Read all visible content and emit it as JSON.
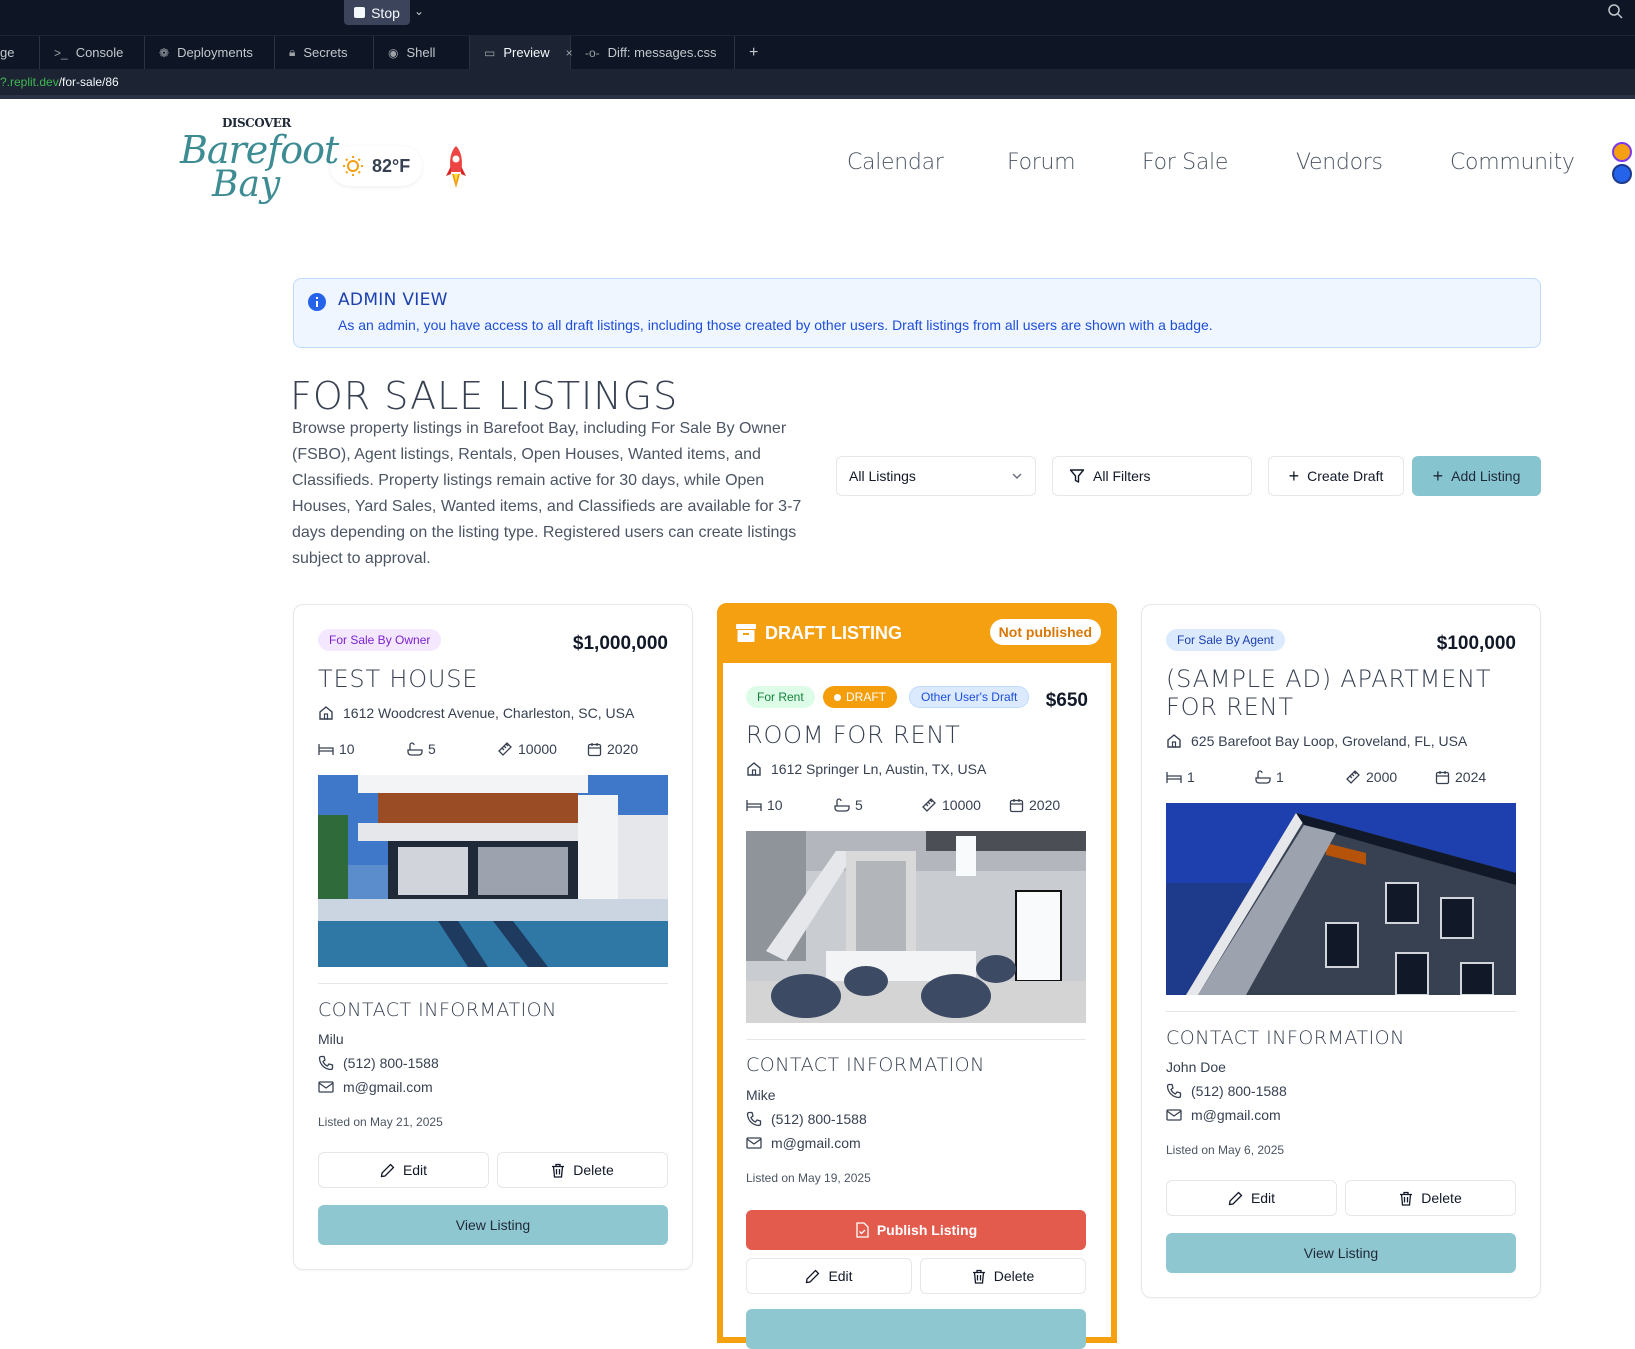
{
  "ide": {
    "stop_label": "Stop",
    "tabs": [
      {
        "icon": "",
        "label": "ge"
      },
      {
        "icon": ">_",
        "label": "Console"
      },
      {
        "icon": "deployments",
        "label": "Deployments"
      },
      {
        "icon": "lock",
        "label": "Secrets"
      },
      {
        "icon": "shell",
        "label": "Shell"
      },
      {
        "icon": "monitor",
        "label": "Preview",
        "active": true
      },
      {
        "icon": "diff",
        "label": "Diff: messages.css"
      }
    ],
    "url_host": "?.replit.dev",
    "url_path": "/for-sale/86"
  },
  "header": {
    "logo_top": "DISCOVER",
    "logo_line1": "Barefoot",
    "logo_line2": "Bay",
    "temperature": "82°F",
    "nav": [
      "Calendar",
      "Forum",
      "For Sale",
      "Vendors",
      "Community"
    ]
  },
  "admin": {
    "title": "ADMIN VIEW",
    "text": "As an admin, you have access to all draft listings, including those created by other users. Draft listings from all users are shown with a badge."
  },
  "page": {
    "title": "FOR SALE LISTINGS",
    "description": "Browse property listings in Barefoot Bay, including For Sale By Owner (FSBO), Agent listings, Rentals, Open Houses, Wanted items, and Classifieds. Property listings remain active for 30 days, while Open Houses, Yard Sales, Wanted items, and Classifieds are available for 3-7 days depending on the listing type. Registered users can create listings subject to approval."
  },
  "toolbar": {
    "select_value": "All Listings",
    "filters_label": "All Filters",
    "create_label": "Create Draft",
    "add_label": "Add Listing"
  },
  "listings": [
    {
      "badge": "For Sale By Owner",
      "price": "$1,000,000",
      "title": "TEST HOUSE",
      "address": "1612 Woodcrest Avenue, Charleston, SC, USA",
      "beds": "10",
      "baths": "5",
      "sqft": "10000",
      "year": "2020",
      "contact_title": "CONTACT INFORMATION",
      "contact_name": "Milu",
      "phone": "(512) 800-1588",
      "email": "m@gmail.com",
      "listed": "Listed on May 21, 2025",
      "edit": "Edit",
      "delete": "Delete",
      "view": "View Listing"
    },
    {
      "draft_header": "DRAFT LISTING",
      "not_published": "Not published",
      "badge": "For Rent",
      "draft_badge": "DRAFT",
      "other_badge": "Other User's Draft",
      "price": "$650",
      "title": "ROOM FOR RENT",
      "address": "1612 Springer Ln, Austin, TX, USA",
      "beds": "10",
      "baths": "5",
      "sqft": "10000",
      "year": "2020",
      "contact_title": "CONTACT INFORMATION",
      "contact_name": "Mike",
      "phone": "(512) 800-1588",
      "email": "m@gmail.com",
      "listed": "Listed on May 19, 2025",
      "publish": "Publish Listing",
      "edit": "Edit",
      "delete": "Delete"
    },
    {
      "badge": "For Sale By Agent",
      "price": "$100,000",
      "title_line1": "(SAMPLE AD) APARTMENT",
      "title_line2": "FOR RENT",
      "address": "625 Barefoot Bay Loop, Groveland, FL, USA",
      "beds": "1",
      "baths": "1",
      "sqft": "2000",
      "year": "2024",
      "contact_title": "CONTACT INFORMATION",
      "contact_name": "John Doe",
      "phone": "(512) 800-1588",
      "email": "m@gmail.com",
      "listed": "Listed on May 6, 2025",
      "edit": "Edit",
      "delete": "Delete",
      "view": "View Listing"
    }
  ],
  "colors": {
    "accent_teal": "#8fc7d1",
    "draft_orange": "#f5a011",
    "publish_red": "#e35b4d",
    "admin_blue": "#1e40af"
  }
}
